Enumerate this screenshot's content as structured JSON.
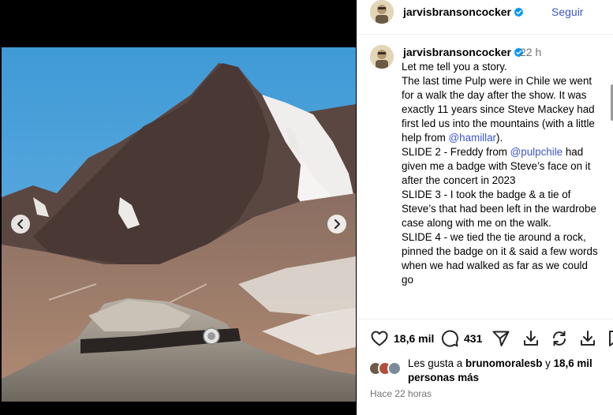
{
  "post": {
    "username": "jarvisbransoncocker",
    "follow_label": "Seguir",
    "time_short": "22 h",
    "caption": {
      "lines": [
        {
          "text": "Let me tell you a story."
        },
        {
          "text": "The last time Pulp were in Chile we went for a walk the day after the show. It was exactly 11 years since Steve Mackey had first led us into the mountains (with a little help from "
        },
        {
          "mention": "@hamillar"
        },
        {
          "text": ")."
        },
        {
          "text": "SLIDE 2 - Freddy from "
        },
        {
          "mention": "@pulpchile"
        },
        {
          "text": " had given me a badge with Steve’s face on it after the concert in 2023"
        },
        {
          "text": "SLIDE 3 - I took the badge & a tie of Steve’s that had been left in the wardrobe case along with me on the walk."
        },
        {
          "text": "SLIDE 4 - we tied the tie around a rock, pinned the badge on it & said a few words when we had walked as far as we could go"
        }
      ],
      "mention_hamillar": "@hamillar",
      "mention_pulpchile": "@pulpchile",
      "p1": "Let me tell you a story.",
      "p2a": "The last time Pulp were in Chile we went for a walk the day after the show. It was exactly 11 years since Steve Mackey had first led us into the mountains (with a little help from ",
      "p2b": ").",
      "p3a": "SLIDE 2 - Freddy from ",
      "p3b": " had given me a badge with Steve’s face on it after the concert in 2023",
      "p4": "SLIDE 3 - I took the badge & a tie of Steve’s that had been left in the wardrobe case along with me on the walk.",
      "p5": "SLIDE 4 - we tied the tie around a rock, pinned the badge on it & said a few words when we had walked as far as we could go"
    },
    "actions": {
      "like_count": "18,6 mil",
      "comment_count": "431"
    },
    "likes": {
      "prefix": "Les gusta a ",
      "first_user": "brunomoralesb",
      "middle": " y ",
      "others": "18,6 mil personas más"
    },
    "time_long": "Hace 22 horas"
  },
  "colors": {
    "link": "#3a56d1",
    "verified": "#0095f6",
    "muted": "#737373"
  },
  "icons": [
    "verified-badge-icon",
    "chevron-left-icon",
    "chevron-right-icon",
    "heart-icon",
    "comment-icon",
    "share-icon",
    "download-icon",
    "repost-icon",
    "save-icon"
  ]
}
